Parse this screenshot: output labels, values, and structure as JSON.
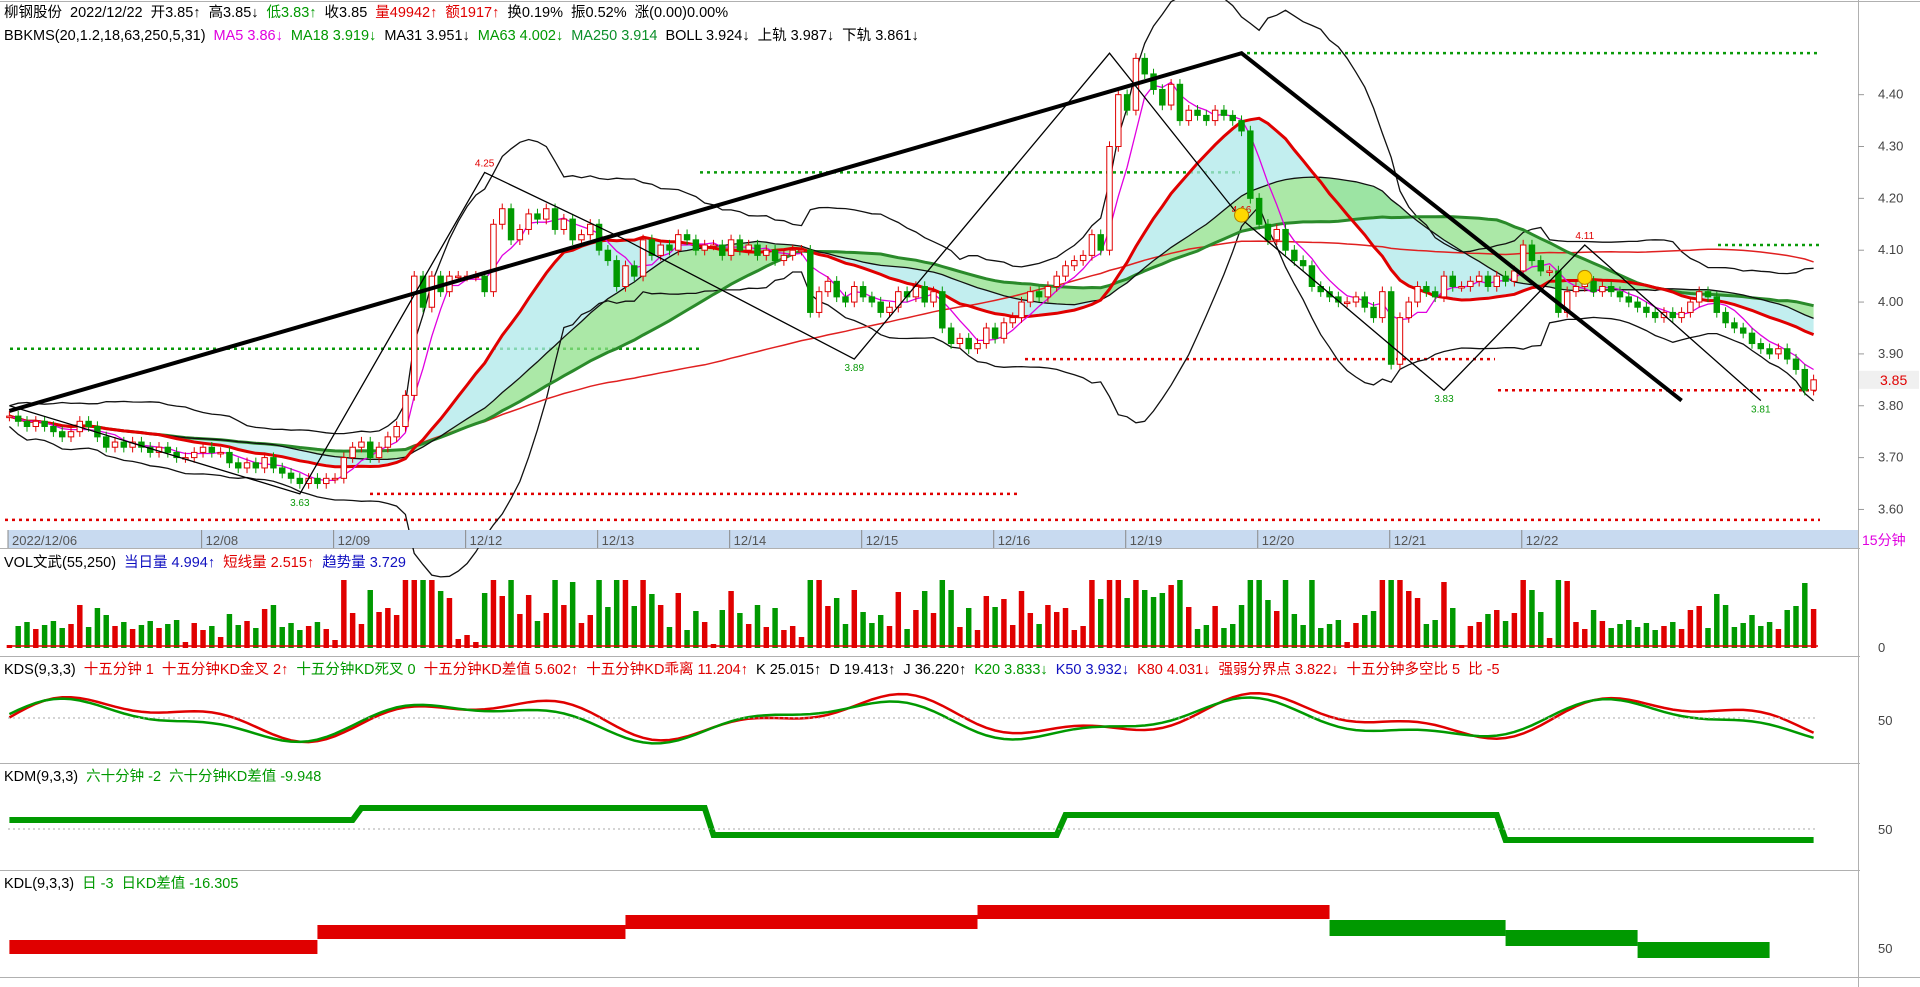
{
  "header": {
    "stock_name": "柳钢股份",
    "date": "2022/12/22",
    "open": "开3.85↑",
    "high": "高3.85↓",
    "low": "低3.83↑",
    "close": "收3.85",
    "volume": "量49942↑",
    "amount": "额1917↑",
    "turnover": "换0.19%",
    "amplitude": "振0.52%",
    "change": "涨(0.00)0.00%"
  },
  "main_indicator": {
    "name": "BBKMS(20,1.2,18,63,250,5,31)",
    "ma5": "MA5 3.86↓",
    "ma18": "MA18 3.919↓",
    "ma31": "MA31 3.951↓",
    "ma63": "MA63 4.002↓",
    "ma250": "MA250 3.914",
    "boll": "BOLL 3.924↓",
    "upper": "上轨 3.987↓",
    "lower": "下轨 3.861↓"
  },
  "vol_panel": {
    "name": "VOL文武(55,250)",
    "today": "当日量 4.994↑",
    "short": "短线量 2.515↑",
    "trend": "趋势量 3.729"
  },
  "kds_panel": {
    "name": "KDS(9,3,3)",
    "items": [
      "十五分钟 1",
      "十五分钟KD金叉 2↑",
      "十五分钟KD死叉 0",
      "十五分钟KD差值 5.602↑",
      "十五分钟KD乖离 11.204↑",
      "K 25.015↑",
      "D 19.413↑",
      "J 36.220↑",
      "K20 3.833↓",
      "K50 3.932↓",
      "K80 4.031↓",
      "强弱分界点 3.822↓",
      "十五分钟多空比 5",
      "比 -5"
    ]
  },
  "kdm_panel": {
    "name": "KDM(9,3,3)",
    "items": [
      "六十分钟 -2",
      "六十分钟KD差值 -9.948"
    ]
  },
  "kdl_panel": {
    "name": "KDL(9,3,3)",
    "items": [
      "日 -3",
      "日KD差值 -16.305"
    ]
  },
  "period_label": "15分钟",
  "colors": {
    "up": "#e00000",
    "down": "#009900",
    "axis_bar": "#c8daf0",
    "band_cyan": "#aee8ea",
    "band_green": "#8fe08a"
  },
  "chart_data": {
    "type": "candlestick",
    "x_axis_labels": [
      "2022/12/06",
      "12/08",
      "12/09",
      "12/12",
      "12/13",
      "12/14",
      "12/15",
      "12/16",
      "12/19",
      "12/20",
      "12/21",
      "12/22"
    ],
    "y_ticks": [
      "4.40",
      "4.30",
      "4.20",
      "4.10",
      "4.00",
      "3.90",
      "3.80",
      "3.70",
      "3.60"
    ],
    "ylim": [
      3.57,
      4.49
    ],
    "last_price": "3.85",
    "annotations": [
      "4.25",
      "3.63",
      "3.89",
      "4.16",
      "3.83",
      "4.11",
      "3.81"
    ],
    "close": [
      3.78,
      3.77,
      3.76,
      3.77,
      3.76,
      3.75,
      3.74,
      3.75,
      3.77,
      3.76,
      3.74,
      3.72,
      3.73,
      3.72,
      3.73,
      3.72,
      3.71,
      3.72,
      3.71,
      3.7,
      3.7,
      3.71,
      3.72,
      3.71,
      3.71,
      3.69,
      3.68,
      3.69,
      3.68,
      3.7,
      3.68,
      3.67,
      3.66,
      3.65,
      3.66,
      3.65,
      3.66,
      3.66,
      3.7,
      3.72,
      3.73,
      3.7,
      3.72,
      3.74,
      3.76,
      3.82,
      4.05,
      3.99,
      4.05,
      4.02,
      4.05,
      4.05,
      4.05,
      4.05,
      4.02,
      4.15,
      4.18,
      4.12,
      4.14,
      4.17,
      4.16,
      4.18,
      4.14,
      4.16,
      4.12,
      4.13,
      4.15,
      4.1,
      4.08,
      4.03,
      4.07,
      4.05,
      4.12,
      4.09,
      4.11,
      4.1,
      4.13,
      4.12,
      4.1,
      4.11,
      4.11,
      4.09,
      4.12,
      4.1,
      4.11,
      4.09,
      4.1,
      4.08,
      4.09,
      4.1,
      4.1,
      3.98,
      4.02,
      4.04,
      4.01,
      4.0,
      4.03,
      4.01,
      4.0,
      3.98,
      3.99,
      4.02,
      4.01,
      4.03,
      4.0,
      4.02,
      3.95,
      3.92,
      3.93,
      3.91,
      3.92,
      3.95,
      3.93,
      3.96,
      3.97,
      4.0,
      4.02,
      4.01,
      4.03,
      4.05,
      4.07,
      4.08,
      4.09,
      4.13,
      4.1,
      4.3,
      4.4,
      4.37,
      4.47,
      4.44,
      4.41,
      4.38,
      4.42,
      4.35,
      4.37,
      4.36,
      4.35,
      4.37,
      4.36,
      4.35,
      4.33,
      4.2,
      4.15,
      4.12,
      4.14,
      4.1,
      4.08,
      4.07,
      4.03,
      4.02,
      4.01,
      4.0,
      4.0,
      4.01,
      3.99,
      3.97,
      4.02,
      3.88,
      3.97,
      4.0,
      4.03,
      4.02,
      4.01,
      4.05,
      4.03,
      4.03,
      4.04,
      4.05,
      4.03,
      4.05,
      4.04,
      4.06,
      4.11,
      4.08,
      4.06,
      4.06,
      3.98,
      4.02,
      4.03,
      4.04,
      4.02,
      4.03,
      4.02,
      4.01,
      4.0,
      3.99,
      3.98,
      3.97,
      3.98,
      3.97,
      3.98,
      4.0,
      4.02,
      4.01,
      3.98,
      3.96,
      3.95,
      3.94,
      3.92,
      3.91,
      3.9,
      3.91,
      3.89,
      3.87,
      3.83,
      3.85
    ]
  }
}
